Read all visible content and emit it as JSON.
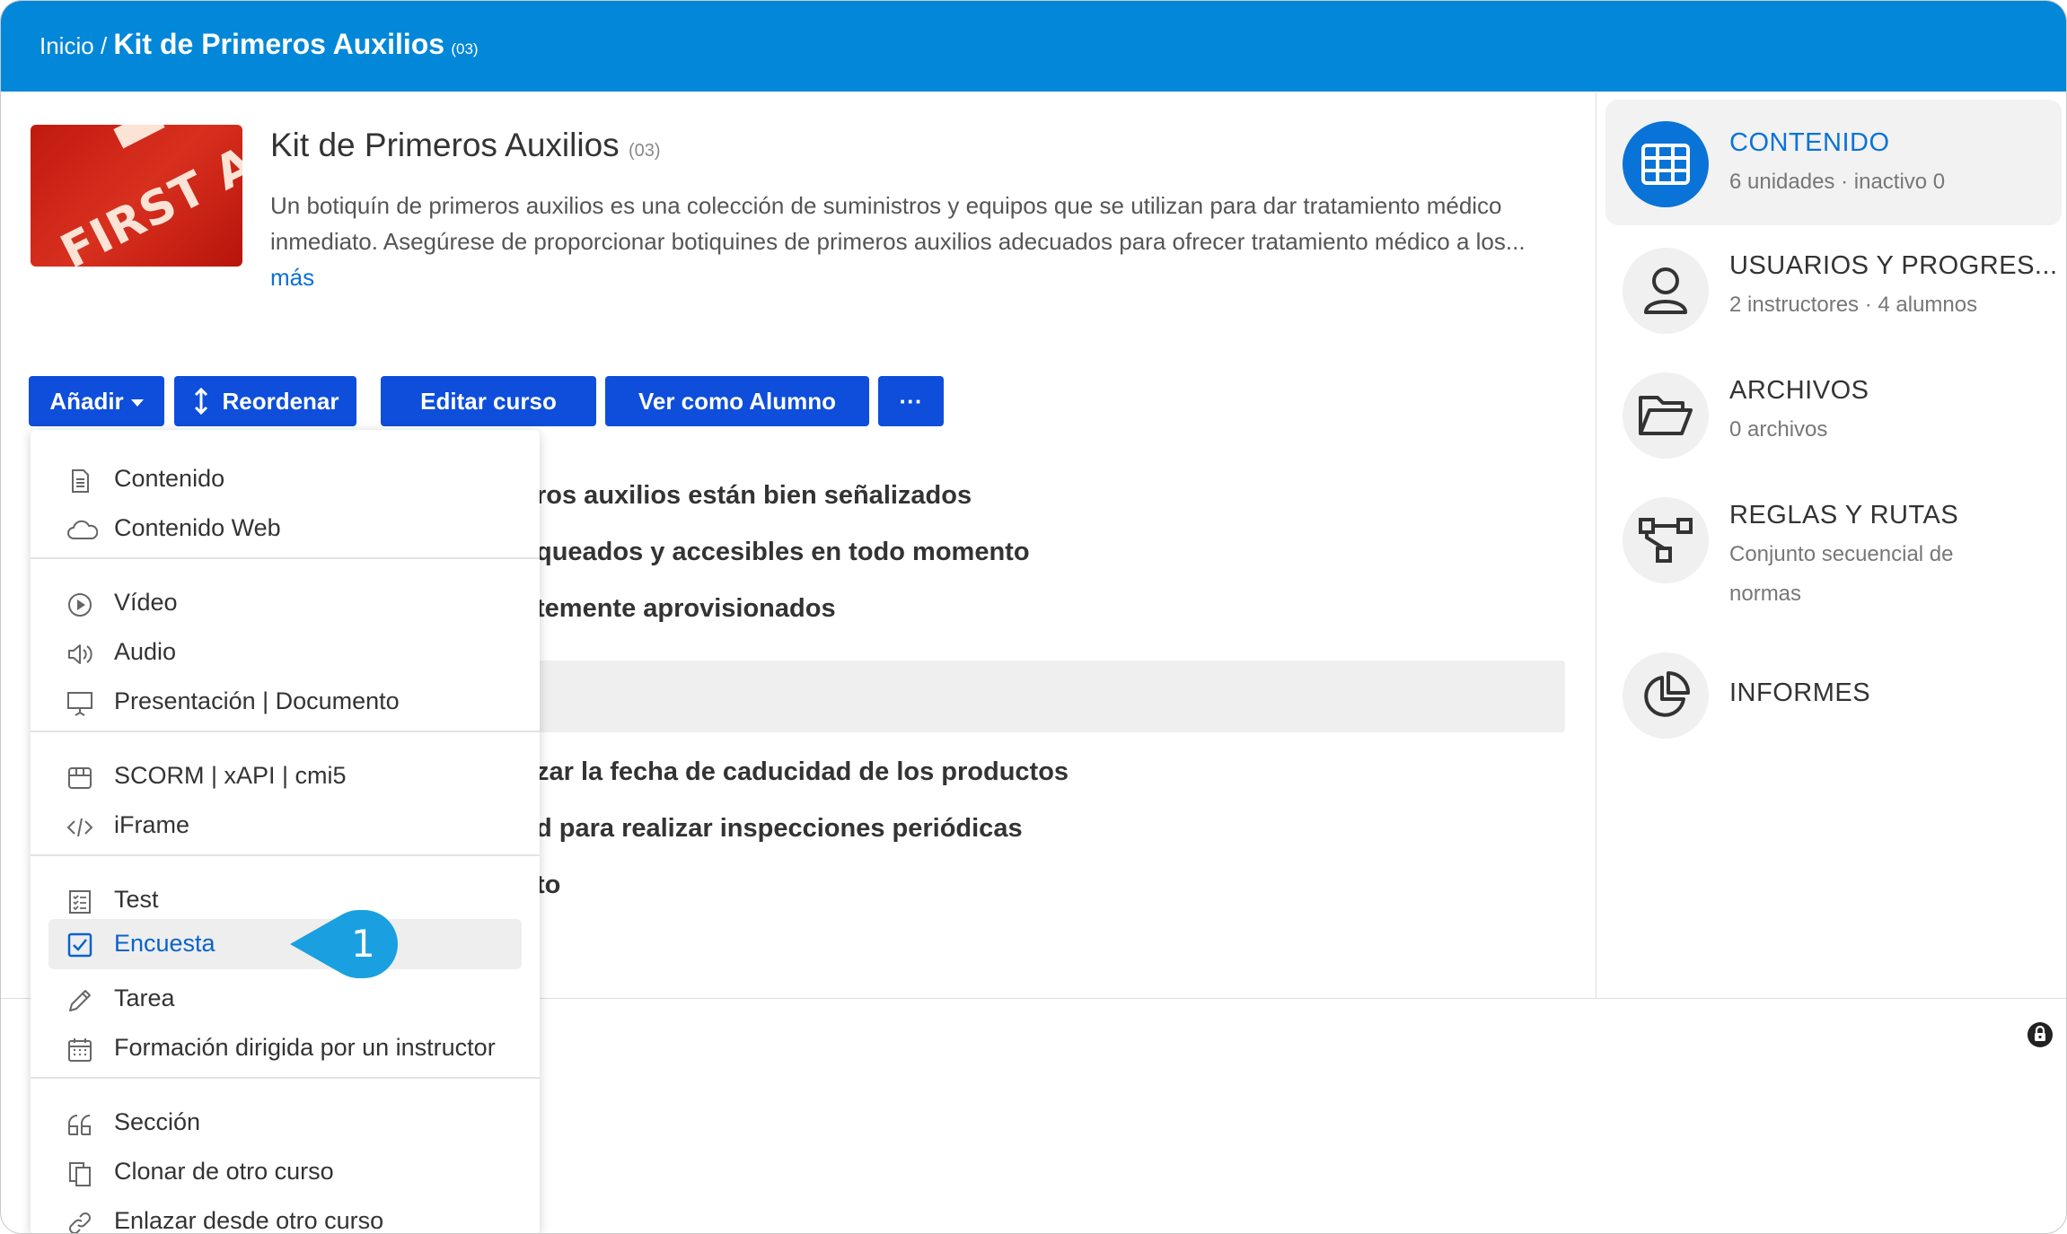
{
  "breadcrumb": {
    "home": "Inicio",
    "separator": "/",
    "course": "Kit de Primeros Auxilios",
    "code": "(03)"
  },
  "course": {
    "thumbnail_text": "FIRST AID",
    "title": "Kit de Primeros Auxilios",
    "code": "(03)",
    "description": "Un botiquín de primeros auxilios es una colección de suministros y equipos que se utilizan para dar tratamiento médico inmediato. Asegúrese de proporcionar botiquines de primeros auxilios adecuados para ofrecer tratamiento médico a los...",
    "more_link": "más"
  },
  "toolbar": {
    "add": "Añadir",
    "reorder": "Reordenar",
    "edit": "Editar curso",
    "view_as": "Ver como Alumno",
    "more": "···"
  },
  "units": [
    "ros auxilios están bien señalizados",
    "queados y accesibles en todo momento",
    "temente aprovisionados",
    "zar la fecha de caducidad de los productos",
    "d para realizar inspecciones periódicas",
    "to"
  ],
  "add_menu": {
    "groups": [
      [
        {
          "label": "Contenido",
          "icon": "document-icon"
        },
        {
          "label": "Contenido Web",
          "icon": "cloud-icon"
        }
      ],
      [
        {
          "label": "Vídeo",
          "icon": "play-icon"
        },
        {
          "label": "Audio",
          "icon": "speaker-icon"
        },
        {
          "label": "Presentación | Documento",
          "icon": "presentation-icon"
        }
      ],
      [
        {
          "label": "SCORM | xAPI | cmi5",
          "icon": "package-icon"
        },
        {
          "label": "iFrame",
          "icon": "code-icon"
        }
      ],
      [
        {
          "label": "Test",
          "icon": "checklist-icon"
        },
        {
          "label": "Encuesta",
          "icon": "checkbox-icon",
          "selected": true
        },
        {
          "label": "Tarea",
          "icon": "pencil-icon"
        },
        {
          "label": "Formación dirigida por un instructor",
          "icon": "calendar-icon"
        }
      ],
      [
        {
          "label": "Sección",
          "icon": "quote-icon"
        },
        {
          "label": "Clonar de otro curso",
          "icon": "clone-icon"
        },
        {
          "label": "Enlazar desde otro curso",
          "icon": "link-icon"
        }
      ]
    ]
  },
  "callout": {
    "number": "1"
  },
  "sidebar": [
    {
      "title": "CONTENIDO",
      "subtitle": "6 unidades · inactivo 0",
      "icon": "grid-icon",
      "active": true
    },
    {
      "title": "USUARIOS Y PROGRES...",
      "subtitle": "2 instructores · 4 alumnos",
      "icon": "user-icon"
    },
    {
      "title": "ARCHIVOS",
      "subtitle": "0 archivos",
      "icon": "folder-icon"
    },
    {
      "title": "REGLAS Y RUTAS",
      "subtitle": "Conjunto secuencial de normas",
      "icon": "flow-icon"
    },
    {
      "title": "INFORMES",
      "subtitle": "",
      "icon": "piechart-icon"
    }
  ],
  "colors": {
    "topbar": "#0287d9",
    "button": "#0e4edb",
    "active": "#0a73d7",
    "callout": "#1aa0e0"
  }
}
